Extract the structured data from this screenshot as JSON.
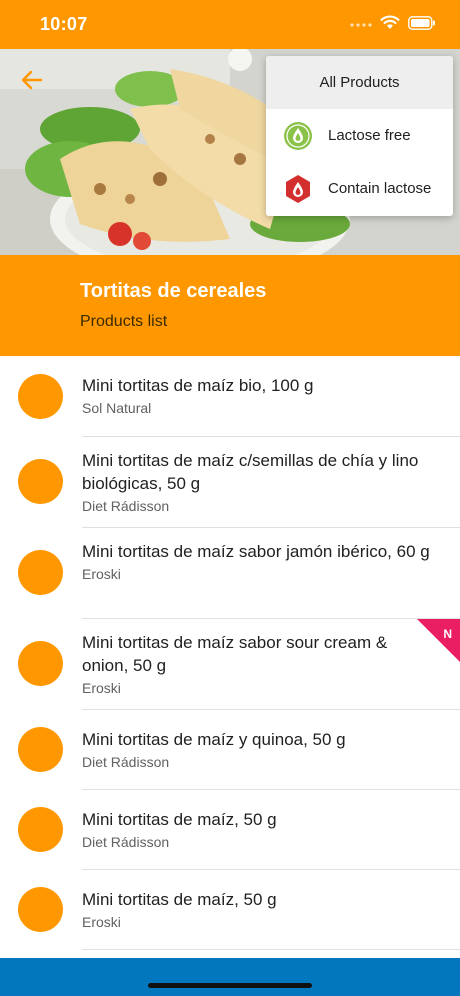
{
  "status_bar": {
    "time": "10:07",
    "icons": [
      "signal-dots-icon",
      "wifi-icon",
      "battery-icon"
    ]
  },
  "hero": {
    "image": "tortilla-wraps-photo"
  },
  "filter_menu": {
    "items": [
      {
        "label": "All Products",
        "icon": "",
        "selected": true
      },
      {
        "label": "Lactose free",
        "icon": "lactose-free-icon",
        "color": "#8BC34A",
        "selected": false
      },
      {
        "label": "Contain lactose",
        "icon": "contains-lactose-icon",
        "color": "#D32F2F",
        "selected": false
      }
    ]
  },
  "header": {
    "title": "Tortitas de cereales",
    "subtitle": "Products list"
  },
  "products": [
    {
      "name": "Mini tortitas de maíz bio, 100 g",
      "brand": "Sol Natural",
      "is_new": false
    },
    {
      "name": "Mini tortitas de maíz c/semillas de chía y lino biológicas, 50 g",
      "brand": "Diet Rádisson",
      "is_new": false
    },
    {
      "name": "Mini tortitas de maíz sabor jamón ibérico, 60 g",
      "brand": "Eroski",
      "is_new": false
    },
    {
      "name": "Mini tortitas de maíz sabor sour cream & onion, 50 g",
      "brand": "Eroski",
      "is_new": true,
      "badge": "N"
    },
    {
      "name": "Mini tortitas de maíz y quinoa, 50 g",
      "brand": "Diet Rádisson",
      "is_new": false
    },
    {
      "name": "Mini tortitas de maíz, 50 g",
      "brand": "Diet Rádisson",
      "is_new": false
    },
    {
      "name": "Mini tortitas de maíz, 50 g",
      "brand": "Eroski",
      "is_new": false
    }
  ],
  "colors": {
    "primary": "#FF9800",
    "bottom_bar": "#0277BD",
    "new_badge": "#E91E63"
  }
}
